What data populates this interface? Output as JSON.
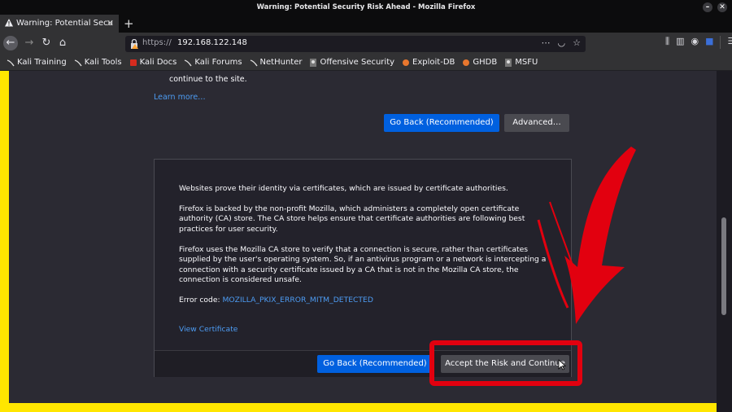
{
  "window": {
    "title": "Warning: Potential Security Risk Ahead - Mozilla Firefox"
  },
  "tab": {
    "label": "Warning: Potential Secu"
  },
  "urlbar": {
    "protocol": "https://",
    "host": "192.168.122.148"
  },
  "bookmarks": [
    "Kali Training",
    "Kali Tools",
    "Kali Docs",
    "Kali Forums",
    "NetHunter",
    "Offensive Security",
    "Exploit-DB",
    "GHDB",
    "MSFU"
  ],
  "page": {
    "continue_text": "continue to the site.",
    "learn_more": "Learn more…",
    "go_back_label": "Go Back (Recommended)",
    "advanced_label": "Advanced…",
    "details": {
      "p1": "Websites prove their identity via certificates, which are issued by certificate authorities.",
      "p2": "Firefox is backed by the non-profit Mozilla, which administers a completely open certificate authority (CA) store. The CA store helps ensure that certificate authorities are following best practices for user security.",
      "p3": "Firefox uses the Mozilla CA store to verify that a connection is secure, rather than certificates supplied by the user's operating system. So, if an antivirus program or a network is intercepting a connection with a security certificate issued by a CA that is not in the Mozilla CA store, the connection is considered unsafe.",
      "error_code_label": "Error code: ",
      "error_code_value": "MOZILLA_PKIX_ERROR_MITM_DETECTED",
      "view_certificate": "View Certificate",
      "go_back_label": "Go Back (Recommended)",
      "accept_label": "Accept the Risk and Continue"
    }
  },
  "colors": {
    "frame": "#ffe600",
    "highlight": "#e2000f",
    "primary_button": "#0060df",
    "link": "#4d9cf3"
  }
}
